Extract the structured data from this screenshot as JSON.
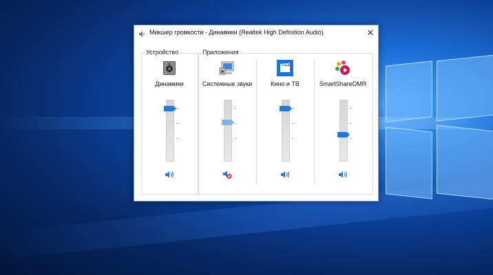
{
  "window": {
    "title": "Микшер громкости - Динамики (Realtek High Definition Audio)",
    "close_glyph": "✕"
  },
  "groups": {
    "device_label": "Устройство",
    "apps_label": "Приложения"
  },
  "channels": [
    {
      "name": "Динамики",
      "icon": "speaker-device-icon",
      "volume_fraction": 0.85,
      "muted": false
    },
    {
      "name": "Системные звуки",
      "icon": "system-sounds-icon",
      "volume_fraction": 0.62,
      "muted": true
    },
    {
      "name": "Кино и ТВ",
      "icon": "movies-tv-icon",
      "volume_fraction": 0.85,
      "muted": false
    },
    {
      "name": "SmartShareDMR",
      "icon": "smartshare-icon",
      "volume_fraction": 0.42,
      "muted": false
    }
  ],
  "colors": {
    "accent": "#2877d2",
    "mute_badge": "#d9262c"
  }
}
